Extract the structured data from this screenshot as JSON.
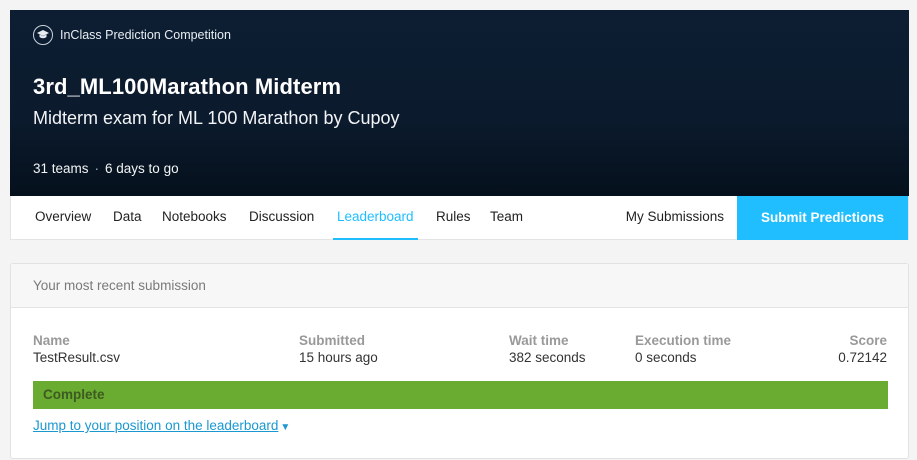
{
  "header": {
    "badge": "InClass Prediction Competition",
    "title": "3rd_ML100Marathon Midterm",
    "subtitle": "Midterm exam for ML 100 Marathon by Cupoy",
    "teams": "31 teams",
    "separator": "·",
    "deadline": "6 days to go"
  },
  "tabs": {
    "items": [
      "Overview",
      "Data",
      "Notebooks",
      "Discussion",
      "Leaderboard",
      "Rules",
      "Team"
    ],
    "active": "Leaderboard",
    "my_submissions": "My Submissions",
    "submit": "Submit Predictions"
  },
  "submission": {
    "heading": "Your most recent submission",
    "columns": {
      "name": {
        "label": "Name",
        "value": "TestResult.csv"
      },
      "submitted": {
        "label": "Submitted",
        "value": "15 hours ago"
      },
      "wait": {
        "label": "Wait time",
        "value": "382 seconds"
      },
      "exec": {
        "label": "Execution time",
        "value": "0 seconds"
      },
      "score": {
        "label": "Score",
        "value": "0.72142"
      }
    },
    "status": "Complete",
    "status_color": "#6aab31",
    "jump_link": "Jump to your position on the leaderboard"
  },
  "colors": {
    "accent": "#20beff",
    "header_bg": "#0d1e33"
  },
  "icons": {
    "badge": "graduation-cap-icon",
    "jump": "caret-down-icon"
  }
}
